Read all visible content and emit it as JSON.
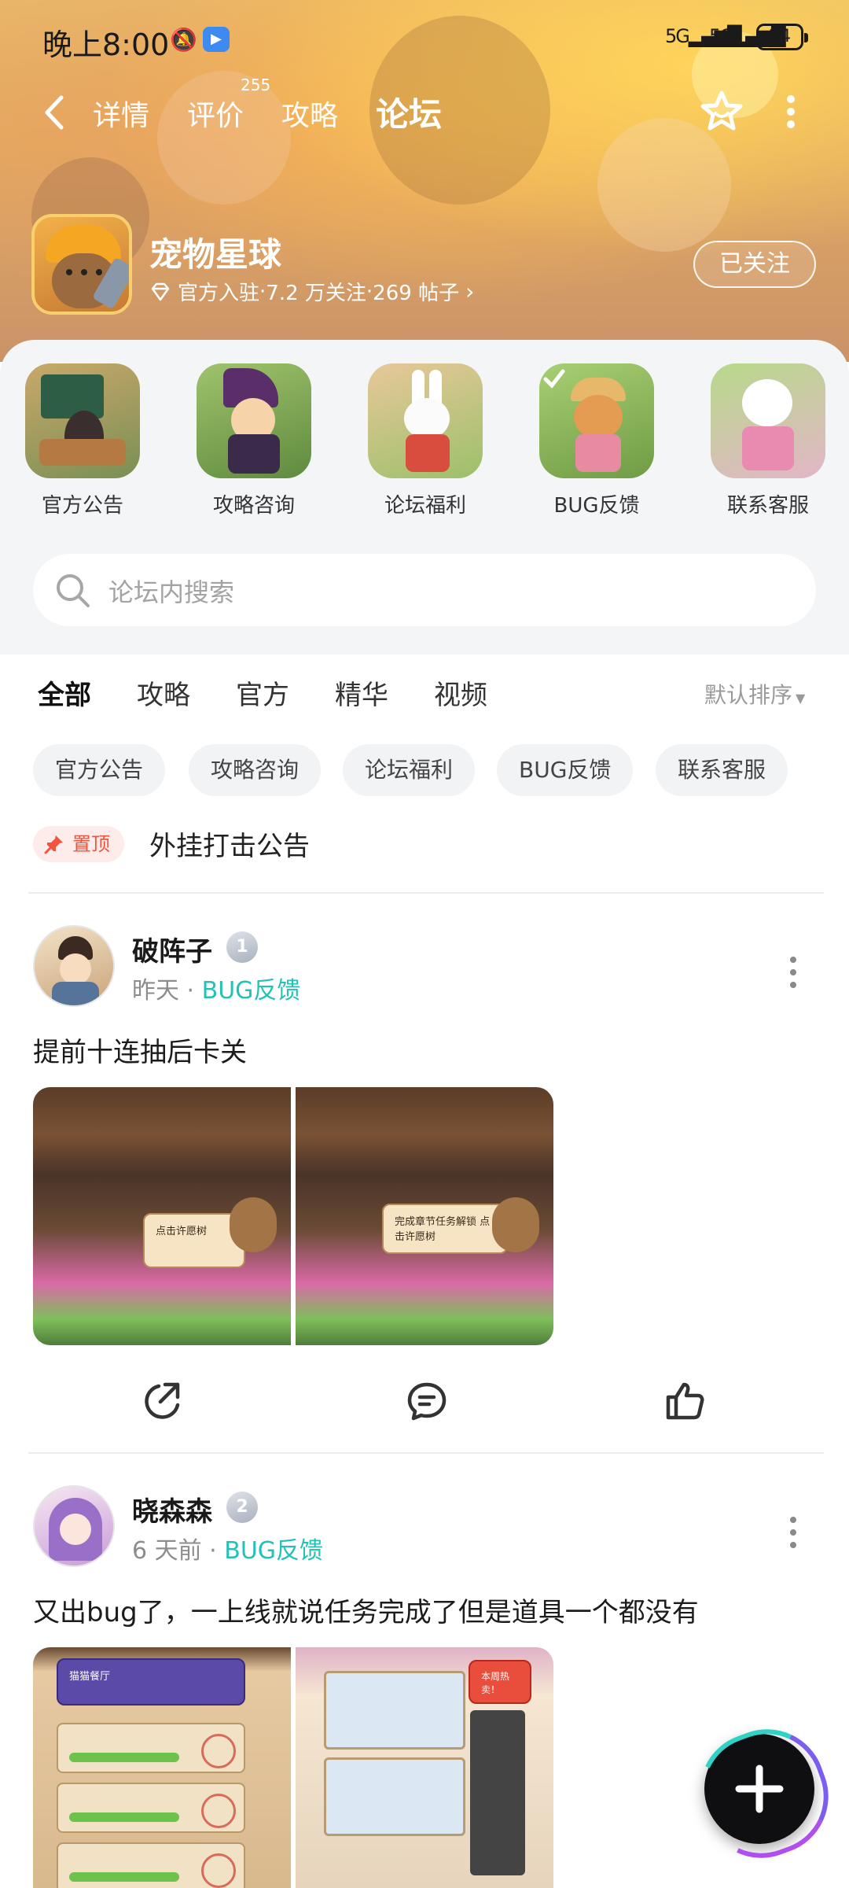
{
  "status_bar": {
    "time": "晚上8:00",
    "signal_1": "5G",
    "signal_2": "5G",
    "battery": "24"
  },
  "nav": {
    "tabs": [
      {
        "label": "详情"
      },
      {
        "label": "评价",
        "count": "255"
      },
      {
        "label": "攻略"
      },
      {
        "label": "论坛",
        "active": true
      }
    ]
  },
  "game": {
    "title": "宠物星球",
    "badge": "官方入驻",
    "followers": "7.2 万关注",
    "posts": "269 帖子",
    "sep": " · ",
    "follow_button": "已关注"
  },
  "categories": [
    {
      "label": "官方公告"
    },
    {
      "label": "攻略咨询"
    },
    {
      "label": "论坛福利"
    },
    {
      "label": "BUG反馈"
    },
    {
      "label": "联系客服"
    }
  ],
  "search": {
    "placeholder": "论坛内搜索"
  },
  "filter_tabs": {
    "items": [
      {
        "label": "全部",
        "active": true
      },
      {
        "label": "攻略"
      },
      {
        "label": "官方"
      },
      {
        "label": "精华"
      },
      {
        "label": "视频"
      }
    ],
    "sort": "默认排序"
  },
  "chips": [
    {
      "label": "官方公告"
    },
    {
      "label": "攻略咨询"
    },
    {
      "label": "论坛福利"
    },
    {
      "label": "BUG反馈"
    },
    {
      "label": "联系客服"
    }
  ],
  "pinned": {
    "badge": "置顶",
    "title": "外挂打击公告"
  },
  "posts": [
    {
      "username": "破阵子",
      "level": "1",
      "time": "昨天",
      "sep": " · ",
      "tag": "BUG反馈",
      "text": "提前十连抽后卡关",
      "images": [
        {
          "caption": "点击许愿树"
        },
        {
          "caption": "完成章节任务解锁 点击许愿树"
        }
      ]
    },
    {
      "username": "晓森森",
      "level": "2",
      "time": "6 天前",
      "sep": " · ",
      "tag": "BUG反馈",
      "text": "又出bug了，一上线就说任务完成了但是道具一个都没有",
      "images": [
        {
          "caption": "猫猫餐厅"
        },
        {
          "caption": "本周热卖！"
        }
      ]
    }
  ],
  "colors": {
    "accent": "#2fd3c5",
    "tag_text": "#22c2b5",
    "pin_red": "#f0553f",
    "panel_bg": "#f4f5f7"
  }
}
